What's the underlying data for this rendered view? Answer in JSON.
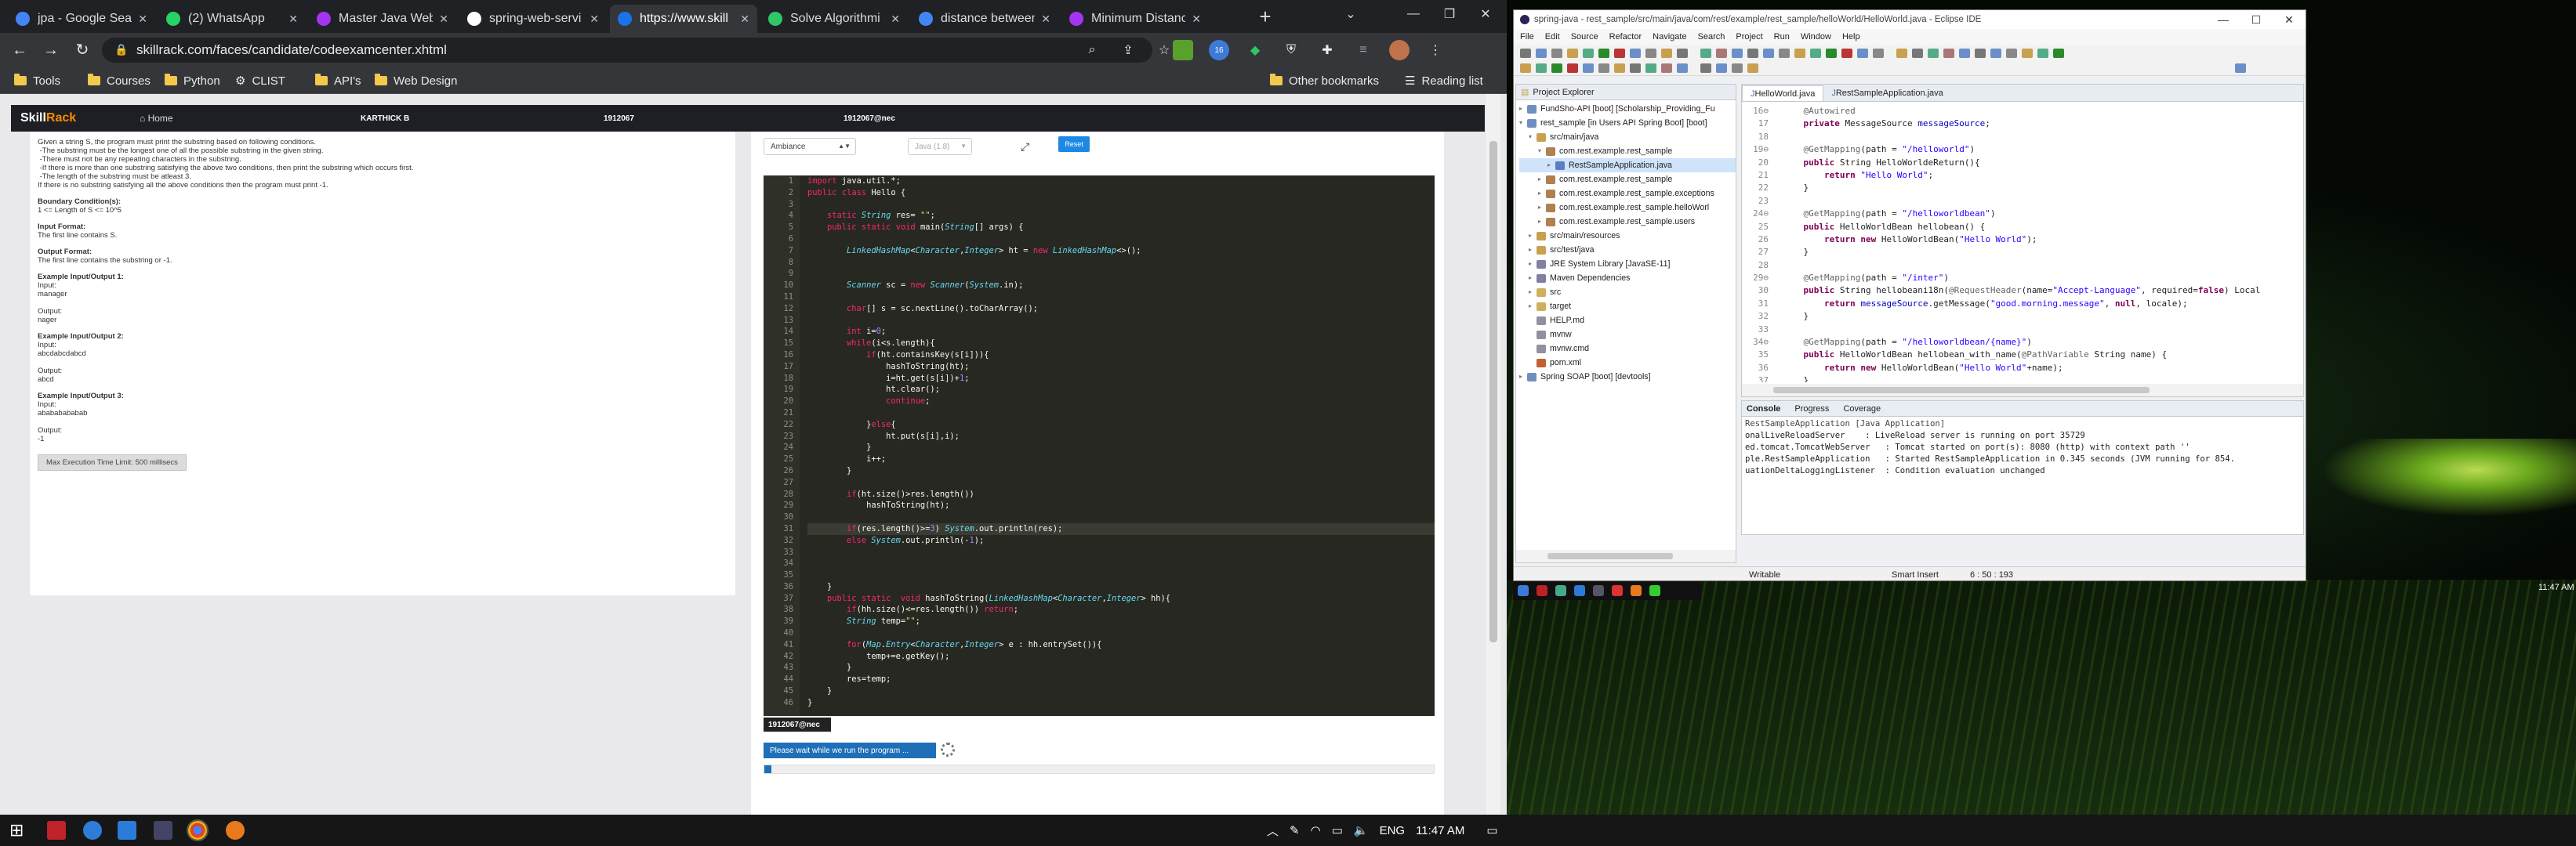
{
  "browser": {
    "tabs": [
      {
        "label": "jpa - Google Sear",
        "favicon_color": "#4285f4"
      },
      {
        "label": "(2) WhatsApp",
        "favicon_color": "#25d366"
      },
      {
        "label": "Master Java Web",
        "favicon_color": "#a435f0"
      },
      {
        "label": "spring-web-servi",
        "favicon_color": "#ffffff"
      },
      {
        "label": "https://www.skill",
        "favicon_color": "#1a73e8"
      },
      {
        "label": "Solve Algorithmi",
        "favicon_color": "#2ec866"
      },
      {
        "label": "distance between",
        "favicon_color": "#4285f4"
      },
      {
        "label": "Minimum Distanc",
        "favicon_color": "#a435f0"
      }
    ],
    "url": "skillrack.com/faces/candidate/codeexamcenter.xhtml",
    "bookmarks": [
      "Tools",
      "Courses",
      "Python",
      "CLIST",
      "API's",
      "Web Design"
    ],
    "other_bookmarks": "Other bookmarks",
    "reading_list": "Reading list",
    "ext_badge": "16"
  },
  "skillrack": {
    "logo_a": "Skill",
    "logo_b": "Rack",
    "home": "Home",
    "user_name": "KARTHICK B",
    "reg_no": "1912067",
    "email": "1912067@nec",
    "problem_lines": [
      "Given a string S, the program must print the substring based on following conditions.",
      " -The substring must be the longest one of all the possible substring in the given string.",
      " -There must not be any repeating characters in the substring.",
      " -If there is more than one substring satisfying the above two conditions, then print the substring which occurs first.",
      " -The length of the substring must be atleast 3.",
      "If there is no substring satisfying all the above conditions then the program must print -1."
    ],
    "sections": [
      {
        "heading": "Boundary Condition(s):",
        "lines": [
          "1 <= Length of S <= 10^5"
        ]
      },
      {
        "heading": "Input Format:",
        "lines": [
          "The first line contains S."
        ]
      },
      {
        "heading": "Output Format:",
        "lines": [
          "The first line contains the substring or -1."
        ]
      },
      {
        "heading": "Example Input/Output 1:",
        "lines": [
          "Input:",
          "manager",
          "",
          "Output:",
          "nager"
        ]
      },
      {
        "heading": "Example Input/Output 2:",
        "lines": [
          "Input:",
          "abcdabcdabcd",
          "",
          "Output:",
          "abcd"
        ]
      },
      {
        "heading": "Example Input/Output 3:",
        "lines": [
          "Input:",
          "abababababab",
          "",
          "Output:",
          "-1"
        ]
      }
    ],
    "time_limit": "Max Execution Time Limit: 500 millisecs",
    "theme_select": "Ambiance",
    "lang_select": "Java (1.8)",
    "reset_label": "Reset",
    "reg_badge": "1912067@nec",
    "wait_msg": "Please wait while we run the program ...",
    "progress_pct": 1,
    "code_lines": [
      "import java.util.*;",
      "public class Hello {",
      "",
      "    static String res= \"\";",
      "    public static void main(String[] args) {",
      "",
      "        LinkedHashMap<Character,Integer> ht = new LinkedHashMap<>();",
      "",
      "",
      "        Scanner sc = new Scanner(System.in);",
      "",
      "        char[] s = sc.nextLine().toCharArray();",
      "",
      "        int i=0;",
      "        while(i<s.length){",
      "            if(ht.containsKey(s[i])){",
      "                hashToString(ht);",
      "                i=ht.get(s[i])+1;",
      "                ht.clear();",
      "                continue;",
      "",
      "            }else{",
      "                ht.put(s[i],i);",
      "            }",
      "            i++;",
      "        }",
      "",
      "        if(ht.size()>res.length())",
      "            hashToString(ht);",
      "",
      "        if(res.length()>=3) System.out.println(res);",
      "        else System.out.println(-1);",
      "",
      "",
      "",
      "    }",
      "    public static  void hashToString(LinkedHashMap<Character,Integer> hh){",
      "        if(hh.size()<=res.length()) return;",
      "        String temp=\"\";",
      "",
      "        for(Map.Entry<Character,Integer> e : hh.entrySet()){",
      "            temp+=e.getKey();",
      "        }",
      "        res=temp;",
      "    }",
      "}"
    ]
  },
  "eclipse": {
    "title": "spring-java - rest_sample/src/main/java/com/rest/example/rest_sample/helloWorld/HelloWorld.java - Eclipse IDE",
    "menu": [
      "File",
      "Edit",
      "Source",
      "Refactor",
      "Navigate",
      "Search",
      "Project",
      "Run",
      "Window",
      "Help"
    ],
    "explorer_title": "Project Explorer",
    "tree": [
      {
        "indent": 0,
        "arrow": ">",
        "label": "FundSho-API [boot] [Scholarship_Providing_Fu",
        "color": "#6f8fbf"
      },
      {
        "indent": 0,
        "arrow": "v",
        "label": "rest_sample [in Users API Spring Boot] [boot]",
        "color": "#6f8fbf"
      },
      {
        "indent": 1,
        "arrow": "v",
        "label": "src/main/java",
        "color": "#c8a050"
      },
      {
        "indent": 2,
        "arrow": "v",
        "label": "com.rest.example.rest_sample",
        "color": "#b08050"
      },
      {
        "indent": 3,
        "arrow": ">",
        "label": "RestSampleApplication.java",
        "color": "#5a7fc0",
        "selected": true
      },
      {
        "indent": 2,
        "arrow": ">",
        "label": "com.rest.example.rest_sample",
        "color": "#b08050"
      },
      {
        "indent": 2,
        "arrow": ">",
        "label": "com.rest.example.rest_sample.exceptions",
        "color": "#b08050"
      },
      {
        "indent": 2,
        "arrow": ">",
        "label": "com.rest.example.rest_sample.helloWorl",
        "color": "#b08050"
      },
      {
        "indent": 2,
        "arrow": ">",
        "label": "com.rest.example.rest_sample.users",
        "color": "#b08050"
      },
      {
        "indent": 1,
        "arrow": ">",
        "label": "src/main/resources",
        "color": "#c8a050"
      },
      {
        "indent": 1,
        "arrow": ">",
        "label": "src/test/java",
        "color": "#c8a050"
      },
      {
        "indent": 1,
        "arrow": ">",
        "label": "JRE System Library [JavaSE-11]",
        "color": "#8080a0"
      },
      {
        "indent": 1,
        "arrow": ">",
        "label": "Maven Dependencies",
        "color": "#8080a0"
      },
      {
        "indent": 1,
        "arrow": ">",
        "label": "src",
        "color": "#d0b060"
      },
      {
        "indent": 1,
        "arrow": ">",
        "label": "target",
        "color": "#d0b060"
      },
      {
        "indent": 1,
        "arrow": "",
        "label": "HELP.md",
        "color": "#9090a0"
      },
      {
        "indent": 1,
        "arrow": "",
        "label": "mvnw",
        "color": "#9090a0"
      },
      {
        "indent": 1,
        "arrow": "",
        "label": "mvnw.cmd",
        "color": "#9090a0"
      },
      {
        "indent": 1,
        "arrow": "",
        "label": "pom.xml",
        "color": "#c06030"
      },
      {
        "indent": 0,
        "arrow": ">",
        "label": "Spring SOAP [boot] [devtools]",
        "color": "#6f8fbf"
      }
    ],
    "editor_tabs": [
      "HelloWorld.java",
      "RestSampleApplication.java"
    ],
    "code_start": 16,
    "java_lines": [
      "    @Autowired",
      "    private MessageSource messageSource;",
      "",
      "    @GetMapping(path = \"/helloworld\")",
      "    public String HelloWorldeReturn(){",
      "        return \"Hello World\";",
      "    }",
      "",
      "    @GetMapping(path = \"/helloworldbean\")",
      "    public HelloWorldBean hellobean() {",
      "        return new HelloWorldBean(\"Hello World\");",
      "    }",
      "",
      "    @GetMapping(path = \"/inter\")",
      "    public String hellobeani18n(@RequestHeader(name=\"Accept-Language\", required=false) Local",
      "        return messageSource.getMessage(\"good.morning.message\", null, locale);",
      "    }",
      "",
      "    @GetMapping(path = \"/helloworldbean/{name}\")",
      "    public HelloWorldBean hellobean_with_name(@PathVariable String name) {",
      "        return new HelloWorldBean(\"Hello World\"+name);",
      "    }",
      "",
      "",
      "}",
      ""
    ],
    "console_tabs": [
      "Console",
      "Progress",
      "Coverage"
    ],
    "console_title": "RestSampleApplication [Java Application]",
    "console_lines": [
      "onalLiveReloadServer    : LiveReload server is running on port 35729",
      "ed.tomcat.TomcatWebServer   : Tomcat started on port(s): 8080 (http) with context path ''",
      "ple.RestSampleApplication   : Started RestSampleApplication in 0.345 seconds (JVM running for 854.",
      "uationDeltaLoggingListener  : Condition evaluation unchanged"
    ],
    "status_writable": "Writable",
    "status_insert": "Smart Insert",
    "status_pos": "6 : 50 : 193"
  },
  "desktop_clock": "11:47 AM",
  "taskbar": {
    "lang": "ENG",
    "time": "11:47 AM"
  }
}
